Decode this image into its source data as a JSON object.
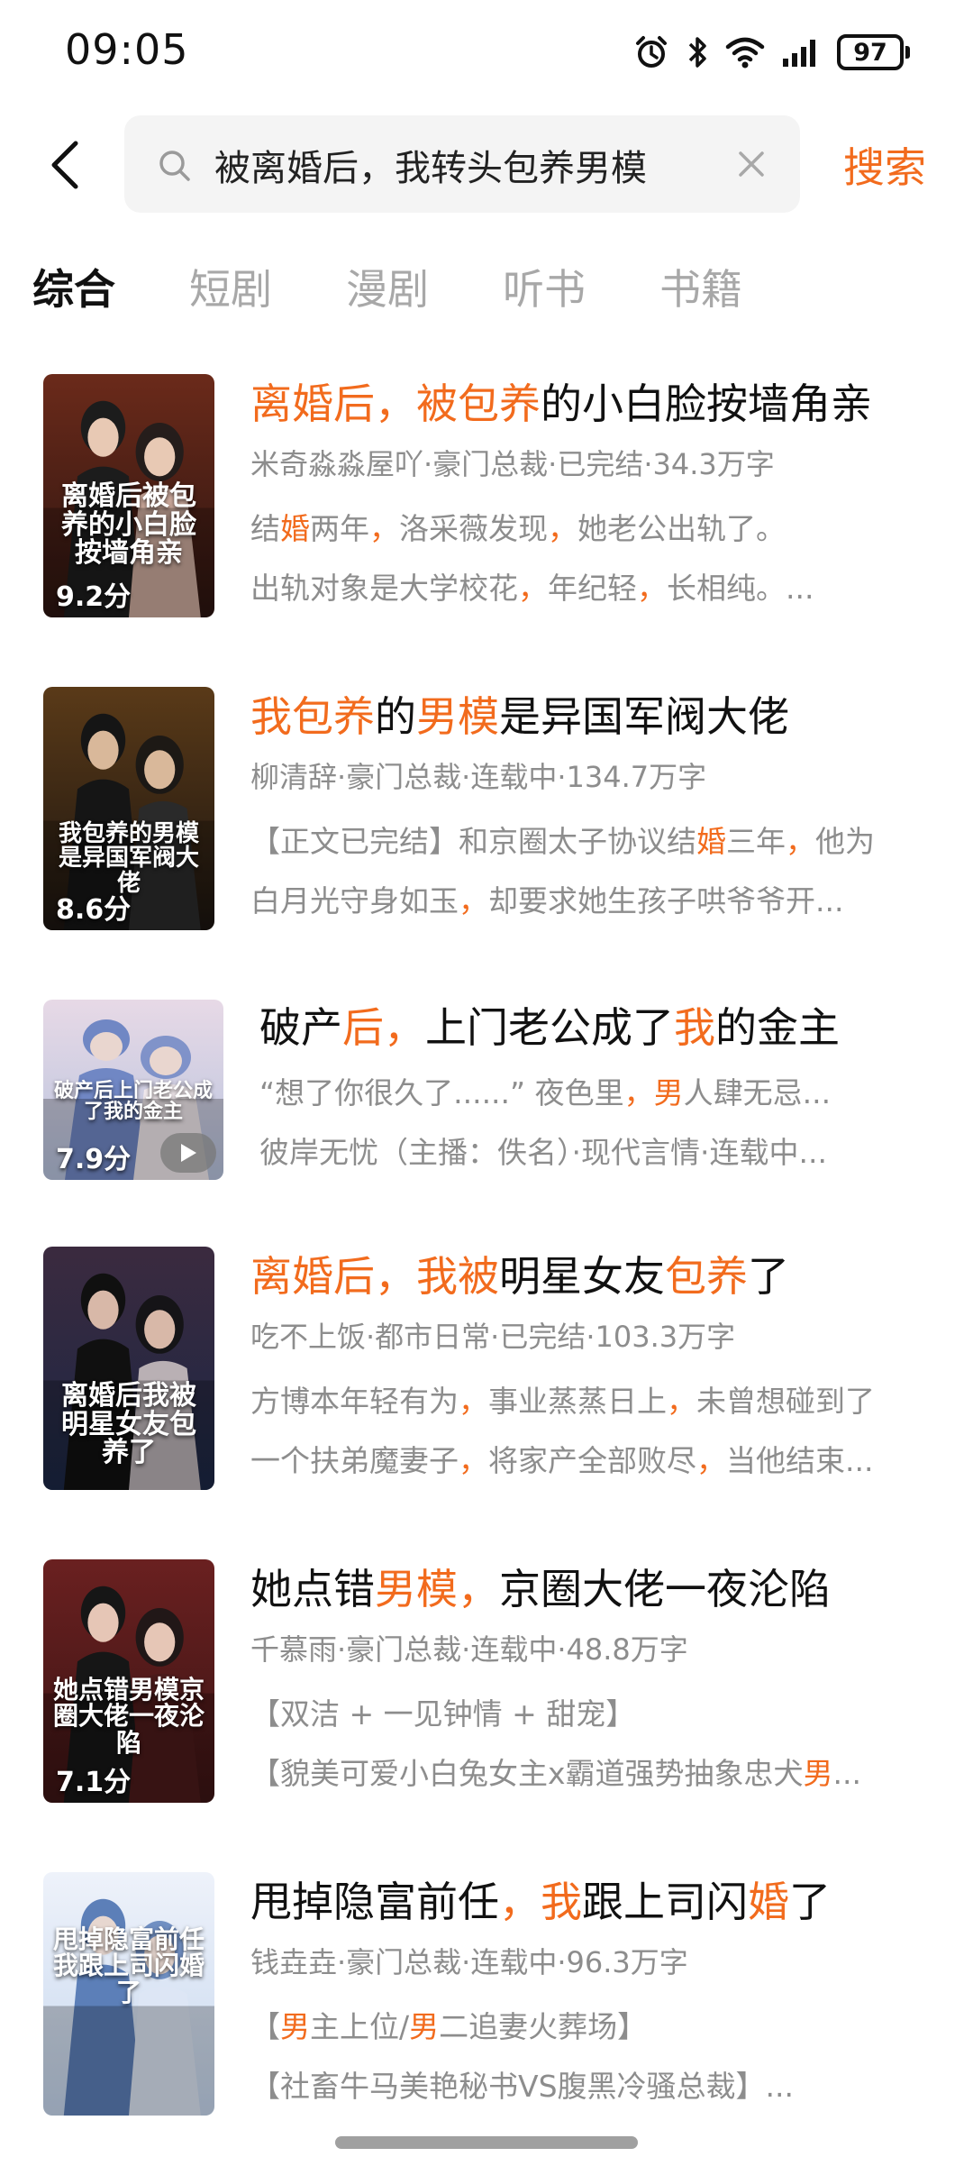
{
  "status_bar": {
    "time": "09:05",
    "battery": "97"
  },
  "search": {
    "query": "被离婚后，我转头包养男模",
    "button_label": "搜索"
  },
  "tabs": [
    {
      "label": "综合",
      "active": true
    },
    {
      "label": "短剧",
      "active": false
    },
    {
      "label": "漫剧",
      "active": false
    },
    {
      "label": "听书",
      "active": false
    },
    {
      "label": "书籍",
      "active": false
    }
  ],
  "results": [
    {
      "title_parts": [
        {
          "text": "离婚后，",
          "hl": true
        },
        {
          "text": "被",
          "hl": true
        },
        {
          "text": "包养",
          "hl": true
        },
        {
          "text": "的小白脸按墙角亲",
          "hl": false
        }
      ],
      "meta": "米奇淼淼屋吖·豪门总裁·已完结·34.3万字",
      "desc_lines": [
        [
          {
            "text": "结",
            "hl": false
          },
          {
            "text": "婚",
            "hl": true
          },
          {
            "text": "两年",
            "hl": false
          },
          {
            "text": "，",
            "hl": true
          },
          {
            "text": "洛采薇发现",
            "hl": false
          },
          {
            "text": "，",
            "hl": true
          },
          {
            "text": "她老公出轨了。",
            "hl": false
          }
        ],
        [
          {
            "text": "出轨对象是大学校花",
            "hl": false
          },
          {
            "text": "，",
            "hl": true
          },
          {
            "text": "年纪轻",
            "hl": false
          },
          {
            "text": "，",
            "hl": true
          },
          {
            "text": "长相纯。...",
            "hl": false
          }
        ]
      ],
      "cover_title": "离婚后被包养的小白脸按墙角亲",
      "cover_score": "9.2分",
      "audio": false
    },
    {
      "title_parts": [
        {
          "text": "我包养",
          "hl": true
        },
        {
          "text": "的",
          "hl": false
        },
        {
          "text": "男模",
          "hl": true
        },
        {
          "text": "是异国军阀大佬",
          "hl": false
        }
      ],
      "meta": "柳清辞·豪门总裁·连载中·134.7万字",
      "desc_lines": [
        [
          {
            "text": "【正文已完结】和京圈太子协议结",
            "hl": false
          },
          {
            "text": "婚",
            "hl": true
          },
          {
            "text": "三年",
            "hl": false
          },
          {
            "text": "，",
            "hl": true
          },
          {
            "text": "他为",
            "hl": false
          }
        ],
        [
          {
            "text": "白月光守身如玉",
            "hl": false
          },
          {
            "text": "，",
            "hl": true
          },
          {
            "text": "却要求她生孩子哄爷爷开...",
            "hl": false
          }
        ]
      ],
      "cover_title": "我包养的男模是异国军阀大佬",
      "cover_score": "8.6分",
      "audio": false
    },
    {
      "title_parts": [
        {
          "text": "破产",
          "hl": false
        },
        {
          "text": "后",
          "hl": true
        },
        {
          "text": "，",
          "hl": true
        },
        {
          "text": "上门老公成了",
          "hl": false
        },
        {
          "text": "我",
          "hl": true
        },
        {
          "text": "的金主",
          "hl": false
        }
      ],
      "meta": "",
      "desc_lines": [
        [
          {
            "text": "“想了你很久了......”         夜色里",
            "hl": false
          },
          {
            "text": "，",
            "hl": true
          },
          {
            "text": "男",
            "hl": true
          },
          {
            "text": "人肆无忌...",
            "hl": false
          }
        ],
        [
          {
            "text": "彼岸无忧（主播：佚名）·现代言情·连载中...",
            "hl": false
          }
        ]
      ],
      "cover_title": "破产后上门老公成了我的金主",
      "cover_score": "7.9分",
      "audio": true
    },
    {
      "title_parts": [
        {
          "text": "离婚后，",
          "hl": true
        },
        {
          "text": "我被",
          "hl": true
        },
        {
          "text": "明星女友",
          "hl": false
        },
        {
          "text": "包养",
          "hl": true
        },
        {
          "text": "了",
          "hl": false
        }
      ],
      "meta": "吃不上饭·都市日常·已完结·103.3万字",
      "desc_lines": [
        [
          {
            "text": "方博本年轻有为",
            "hl": false
          },
          {
            "text": "，",
            "hl": true
          },
          {
            "text": "事业蒸蒸日上",
            "hl": false
          },
          {
            "text": "，",
            "hl": true
          },
          {
            "text": "未曾想碰到了",
            "hl": false
          }
        ],
        [
          {
            "text": "一个扶弟魔妻子",
            "hl": false
          },
          {
            "text": "，",
            "hl": true
          },
          {
            "text": "将家产全部败尽",
            "hl": false
          },
          {
            "text": "，",
            "hl": true
          },
          {
            "text": "当他结束...",
            "hl": false
          }
        ]
      ],
      "cover_title": "离婚后我被明星女友包养了",
      "cover_score": "",
      "audio": false
    },
    {
      "title_parts": [
        {
          "text": "她点错",
          "hl": false
        },
        {
          "text": "男模",
          "hl": true
        },
        {
          "text": "，",
          "hl": true
        },
        {
          "text": "京圈大佬一夜沦陷",
          "hl": false
        }
      ],
      "meta": "千慕雨·豪门总裁·连载中·48.8万字",
      "desc_lines": [
        [
          {
            "text": "【双洁 + 一见钟情 + 甜宠】",
            "hl": false
          }
        ],
        [
          {
            "text": "【貌美可爱小白兔女主x霸道强势抽象忠犬",
            "hl": false
          },
          {
            "text": "男",
            "hl": true
          },
          {
            "text": "...",
            "hl": false
          }
        ]
      ],
      "cover_title": "她点错男模京圈大佬一夜沦陷",
      "cover_score": "7.1分",
      "audio": false
    },
    {
      "title_parts": [
        {
          "text": "甩掉隐富前任",
          "hl": false
        },
        {
          "text": "，",
          "hl": true
        },
        {
          "text": "我",
          "hl": true
        },
        {
          "text": "跟上司闪",
          "hl": false
        },
        {
          "text": "婚",
          "hl": true
        },
        {
          "text": "了",
          "hl": false
        }
      ],
      "meta": "钱垚垚·豪门总裁·连载中·96.3万字",
      "desc_lines": [
        [
          {
            "text": "【",
            "hl": false
          },
          {
            "text": "男",
            "hl": true
          },
          {
            "text": "主上位/",
            "hl": false
          },
          {
            "text": "男",
            "hl": true
          },
          {
            "text": "二追妻火葬场】",
            "hl": false
          }
        ],
        [
          {
            "text": "【社畜牛马美艳秘书VS腹黑冷骚总裁】...",
            "hl": false
          }
        ]
      ],
      "cover_title": "甩掉隐富前任我跟上司闪婚了",
      "cover_score": "",
      "audio": false
    }
  ]
}
